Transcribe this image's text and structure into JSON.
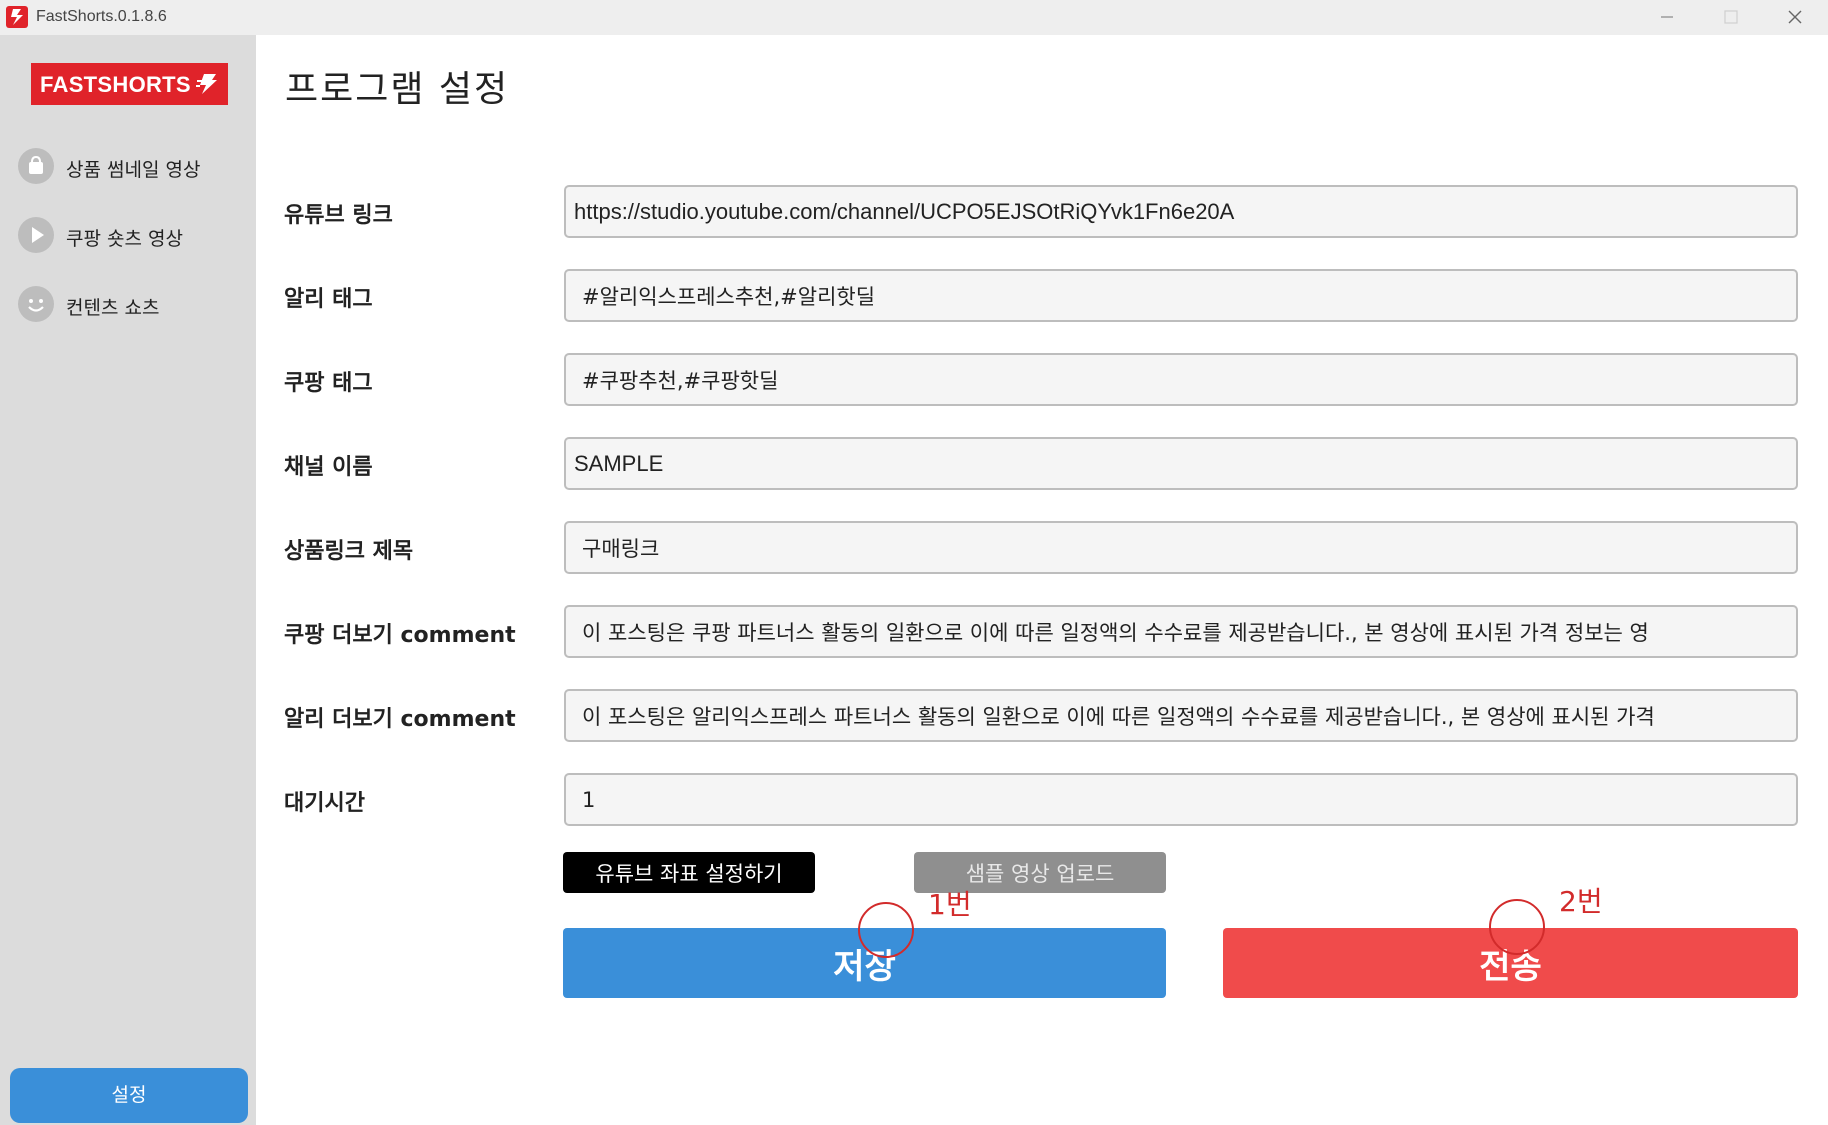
{
  "window": {
    "title": "FastShorts.0.1.8.6",
    "controls": [
      "minimize-icon",
      "maximize-icon",
      "close-icon"
    ]
  },
  "sidebar": {
    "logo_text": "FASTSHORTS",
    "items": [
      {
        "label": "상품 썸네일 영상",
        "icon": "shopping-bag-icon"
      },
      {
        "label": "쿠팡 숏츠 영상",
        "icon": "play-icon"
      },
      {
        "label": "컨텐츠 쇼츠",
        "icon": "smiley-icon"
      }
    ],
    "settings_label": "설정"
  },
  "main": {
    "title": "프로그램 설정",
    "fields": [
      {
        "label": "유튜브 링크",
        "value": "https://studio.youtube.com/channel/UCPO5EJSOtRiQYvk1Fn6e20A"
      },
      {
        "label": "알리 태그",
        "value": "#알리익스프레스추천,#알리핫딜"
      },
      {
        "label": "쿠팡 태그",
        "value": "#쿠팡추천,#쿠팡핫딜"
      },
      {
        "label": "채널 이름",
        "value": "SAMPLE"
      },
      {
        "label": "상품링크 제목",
        "value": "구매링크"
      },
      {
        "label": "쿠팡 더보기 comment",
        "value": "이 포스팅은 쿠팡 파트너스 활동의 일환으로 이에 따른 일정액의 수수료를 제공받습니다., 본 영상에 표시된 가격 정보는 영"
      },
      {
        "label": "알리 더보기 comment",
        "value": "이 포스팅은 알리익스프레스 파트너스 활동의 일환으로 이에 따른 일정액의 수수료를 제공받습니다., 본 영상에 표시된 가격"
      },
      {
        "label": "대기시간",
        "value": "1"
      }
    ],
    "buttons": {
      "youtube_coords": "유튜브 좌표 설정하기",
      "sample_upload": "샘플 영상 업로드",
      "save": "저장",
      "send": "전송"
    }
  },
  "annotations": {
    "first": "1번",
    "second": "2번",
    "color": "#d22b2b"
  },
  "colors": {
    "brand_red": "#e0232a",
    "save_blue": "#3a8fd9",
    "send_red": "#f04b4b",
    "sidebar_bg": "#dcdcdc"
  }
}
